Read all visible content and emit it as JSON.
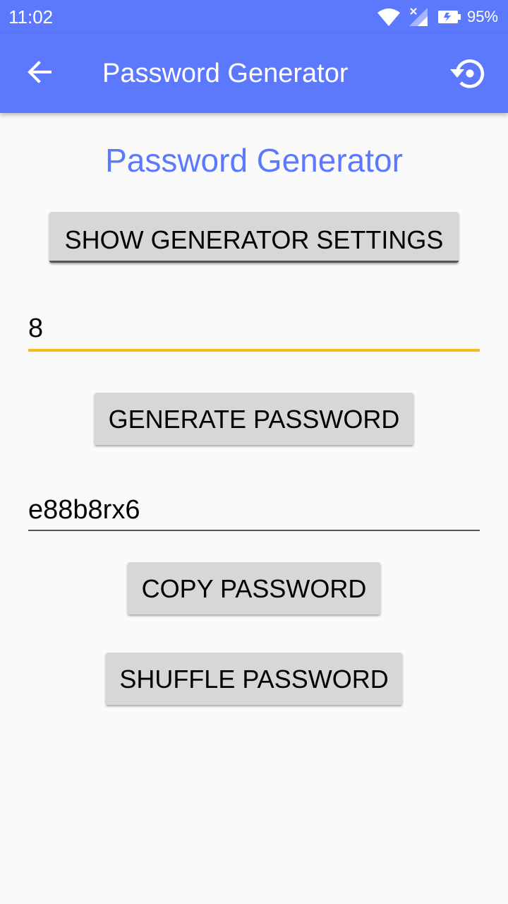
{
  "status_bar": {
    "time": "11:02",
    "battery_percent": "95%",
    "icons": [
      "wifi-icon",
      "cell-signal-icon",
      "battery-icon"
    ]
  },
  "app_bar": {
    "title": "Password Generator",
    "back_icon": "arrow-back-icon",
    "reset_icon": "reset-icon"
  },
  "main": {
    "heading": "Password Generator",
    "settings_button": "SHOW GENERATOR SETTINGS",
    "length_value": "8",
    "generate_button": "GENERATE PASSWORD",
    "password_value": "e88b8rx6",
    "copy_button": "COPY PASSWORD",
    "shuffle_button": "SHUFFLE PASSWORD"
  },
  "colors": {
    "primary": "#5c79fe",
    "accent": "#fbbb12",
    "button_bg": "#d6d7d7",
    "background": "#fafafa"
  }
}
